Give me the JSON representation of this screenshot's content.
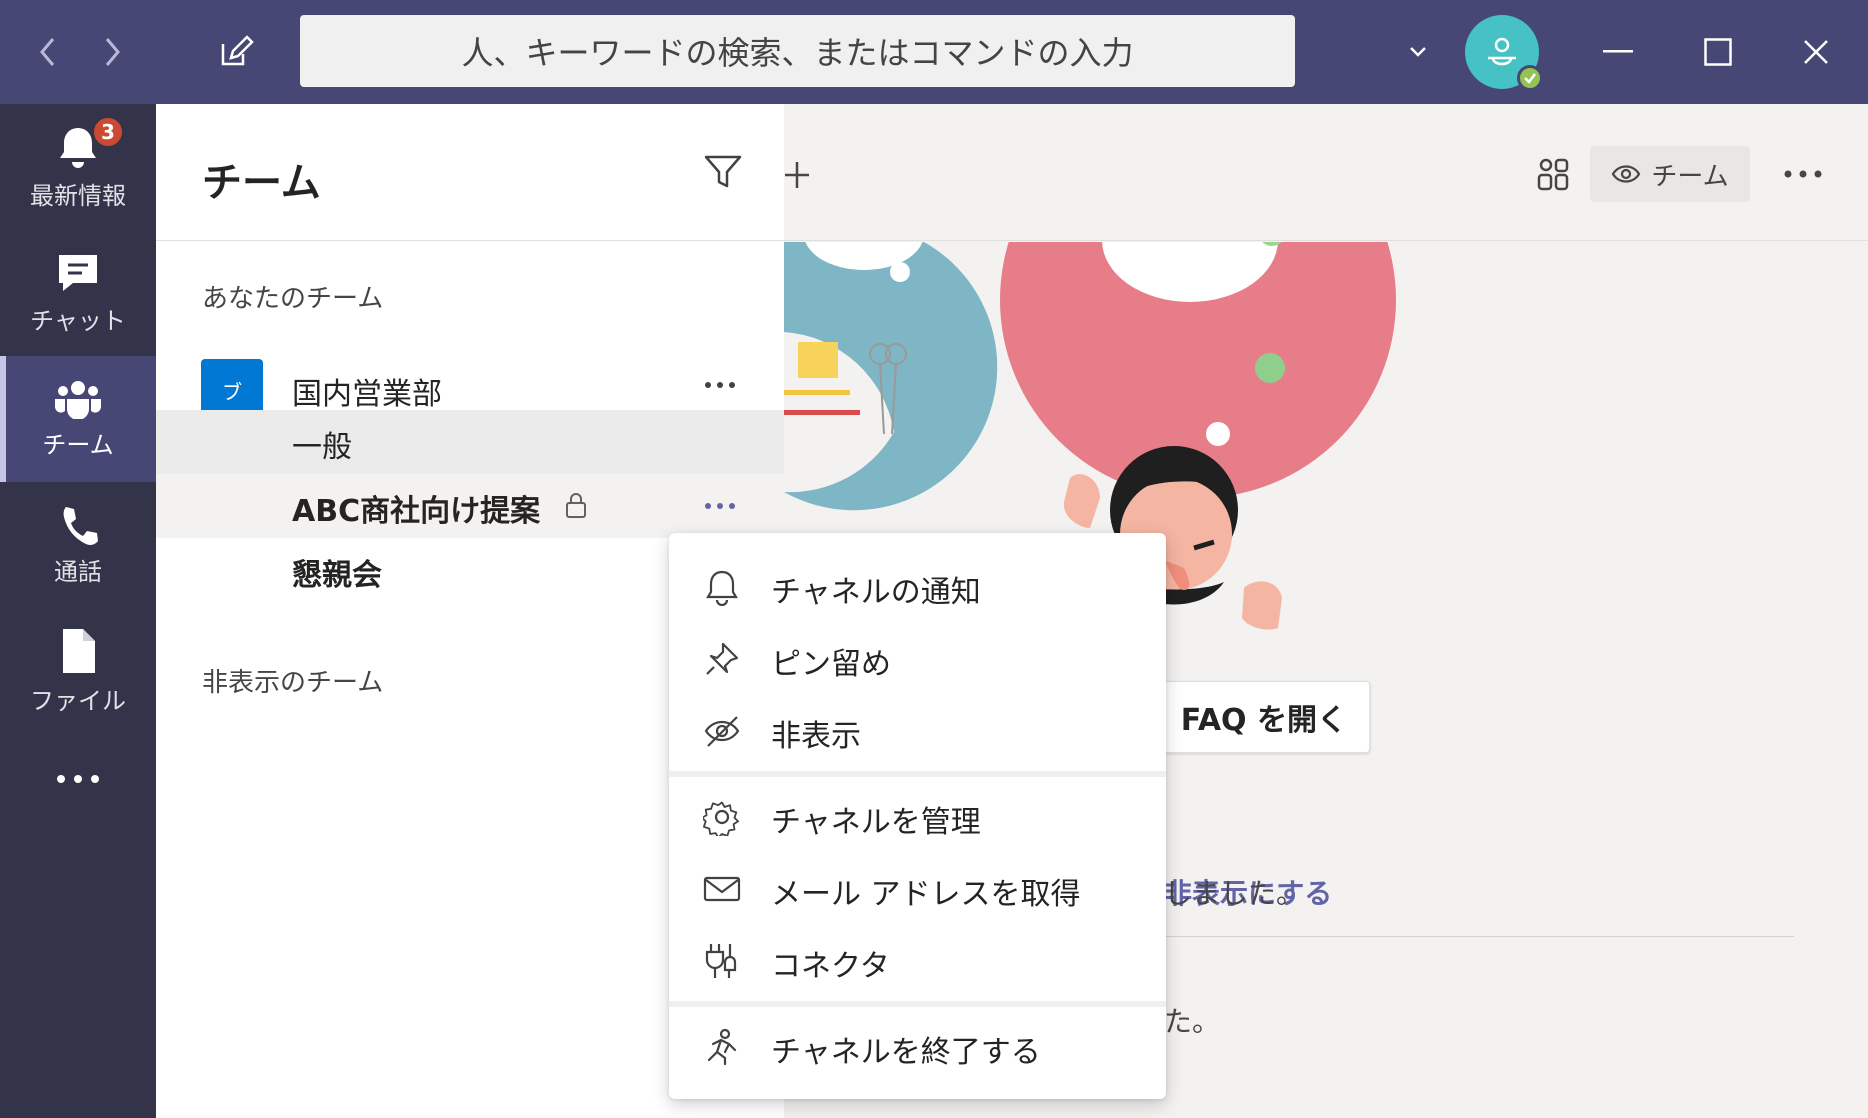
{
  "titlebar": {
    "search_placeholder": "人、キーワードの検索、またはコマンドの入力"
  },
  "rail": {
    "items": [
      {
        "label": "最新情報",
        "icon": "bell-icon",
        "badge": "3"
      },
      {
        "label": "チャット",
        "icon": "chat-icon"
      },
      {
        "label": "チーム",
        "icon": "teams-icon",
        "active": true
      },
      {
        "label": "通話",
        "icon": "phone-icon"
      },
      {
        "label": "ファイル",
        "icon": "file-icon"
      }
    ]
  },
  "panel": {
    "title": "チーム",
    "your_teams_label": "あなたのチーム",
    "team": {
      "name": "国内営業部",
      "logo_text": "ブ"
    },
    "channels": [
      {
        "name": "一般"
      },
      {
        "name": "ABC商社向け提案",
        "private": true
      },
      {
        "name": "懇親会"
      }
    ],
    "hidden_teams_label": "非表示のチーム"
  },
  "main": {
    "view_button": "チーム",
    "faq_button": "FAQ を開く",
    "hide_link": "非表示にする",
    "fragment_1": "しました。",
    "fragment_2": "た。"
  },
  "context_menu": {
    "items": [
      {
        "label": "チャネルの通知",
        "icon": "bell-icon"
      },
      {
        "label": "ピン留め",
        "icon": "pin-icon"
      },
      {
        "label": "非表示",
        "icon": "eye-off-icon"
      },
      {
        "label": "チャネルを管理",
        "icon": "gear-icon"
      },
      {
        "label": "メール アドレスを取得",
        "icon": "mail-icon"
      },
      {
        "label": "コネクタ",
        "icon": "connector-icon"
      },
      {
        "label": "チャネルを終了する",
        "icon": "leave-icon"
      }
    ]
  },
  "colors": {
    "titlebar": "#464775",
    "rail": "#33344a",
    "accent": "#6264a7",
    "badge": "#cc4a31"
  }
}
